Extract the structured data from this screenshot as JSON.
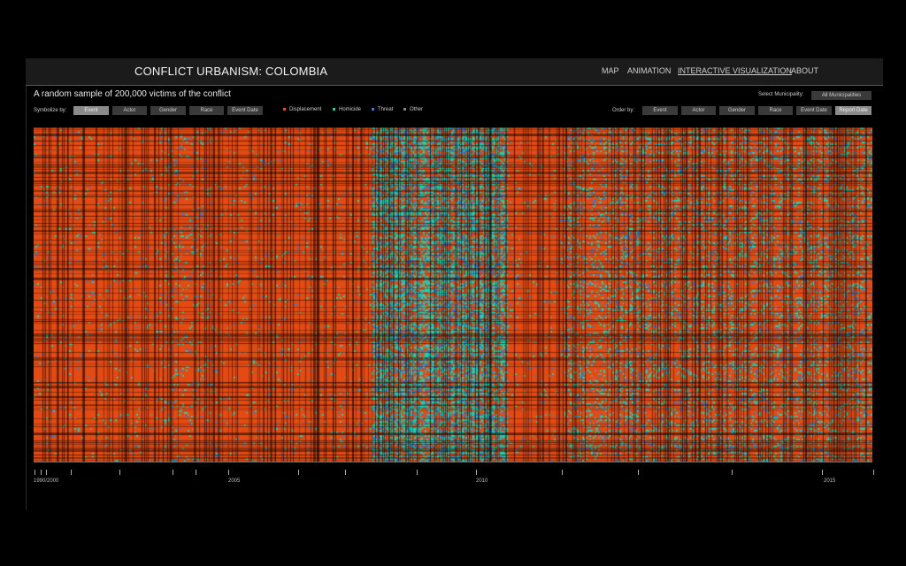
{
  "header": {
    "title": "CONFLICT URBANISM: COLOMBIA",
    "nav": [
      {
        "label": "MAP",
        "active": false
      },
      {
        "label": "ANIMATION",
        "active": false
      },
      {
        "label": "INTERACTIVE VISUALIZATION",
        "active": true
      },
      {
        "label": "ABOUT",
        "active": false
      }
    ]
  },
  "subtitle": "A random sample of 200,000 victims of the conflict",
  "municipality": {
    "label": "Select Municipality:",
    "value": "All Municipalities"
  },
  "symbolize": {
    "label": "Symbolize by:",
    "options": [
      "Event",
      "Actor",
      "Gender",
      "Race",
      "Event Date"
    ],
    "selected": "Event"
  },
  "legend": [
    {
      "label": "Displacement",
      "color": "#ff4a10"
    },
    {
      "label": "Homicide",
      "color": "#16d4b0"
    },
    {
      "label": "Threat",
      "color": "#2f7bd6"
    },
    {
      "label": "Other",
      "color": "#888888"
    }
  ],
  "order": {
    "label": "Order by:",
    "options": [
      "Event",
      "Actor",
      "Gender",
      "Race",
      "Event Date",
      "Report Date"
    ],
    "selected": "Report Date"
  },
  "axis": {
    "labels": [
      "1990",
      "2000",
      "2005",
      "2010",
      "2015"
    ]
  },
  "colors": {
    "background": "#000000",
    "displacement": "#e44a12",
    "homicide": "#16d4b0",
    "threat": "#2f7bd6",
    "other": "#888888"
  }
}
